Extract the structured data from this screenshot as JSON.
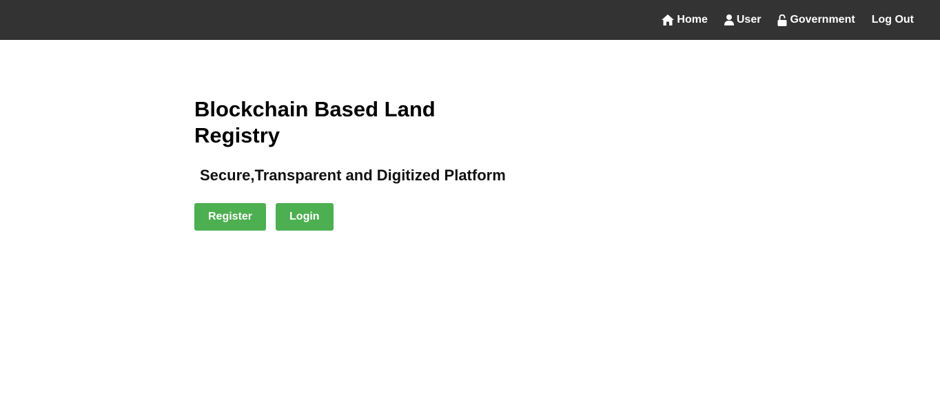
{
  "nav": {
    "items": [
      {
        "label": "Home",
        "icon": "home-icon"
      },
      {
        "label": "User",
        "icon": "user-icon"
      },
      {
        "label": "Government",
        "icon": "lock-icon"
      },
      {
        "label": "Log Out"
      }
    ]
  },
  "hero": {
    "title": "Blockchain Based Land Registry",
    "subtitle": "Secure,Transparent and Digitized Platform",
    "register_label": "Register",
    "login_label": "Login"
  },
  "colors": {
    "navbar": "#333333",
    "button": "#4caf50",
    "nav_text": "#ffffff"
  }
}
